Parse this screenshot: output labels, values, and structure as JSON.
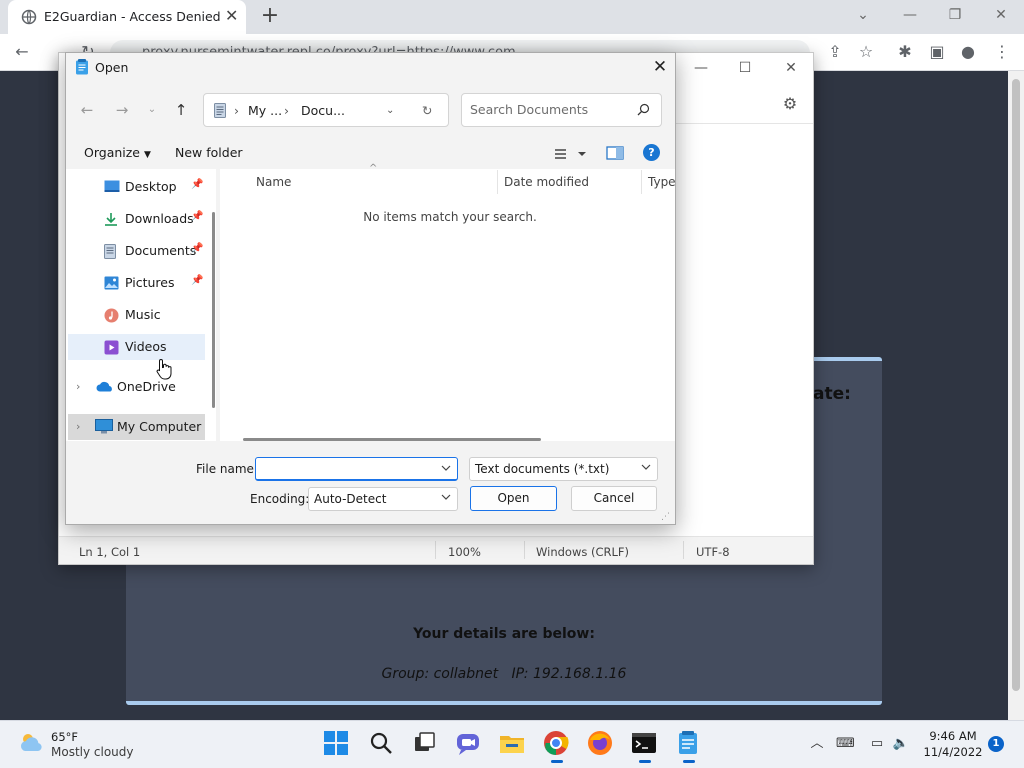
{
  "browser": {
    "tab_title": "E2Guardian - Access Denied",
    "tab_close": "✕",
    "new_tab": "+",
    "url": "proxy.nursemintwater.repl.co/proxy?url=https://www.com"
  },
  "page": {
    "heading_tail": "ate:",
    "details_title": "Your details are below:",
    "details_line": "Group: collabnet   IP: 192.168.1.16"
  },
  "notepad": {
    "status": {
      "position": "Ln 1, Col 1",
      "zoom": "100%",
      "line_endings": "Windows (CRLF)",
      "encoding": "UTF-8"
    }
  },
  "dialog": {
    "title": "Open",
    "close": "✕",
    "breadcrumb": [
      "My ...",
      "Docu..."
    ],
    "search_placeholder": "Search Documents",
    "organize": "Organize",
    "new_folder": "New folder",
    "help": "?",
    "nav": [
      {
        "label": "Desktop",
        "icon": "desktop-icon",
        "pinned": true
      },
      {
        "label": "Downloads",
        "icon": "download-icon",
        "pinned": true
      },
      {
        "label": "Documents",
        "icon": "documents-icon",
        "pinned": true
      },
      {
        "label": "Pictures",
        "icon": "pictures-icon",
        "pinned": true
      },
      {
        "label": "Music",
        "icon": "music-icon",
        "pinned": false
      },
      {
        "label": "Videos",
        "icon": "videos-icon",
        "pinned": false,
        "hovered": true
      },
      {
        "label": "OneDrive",
        "icon": "onedrive-icon",
        "expandable": true
      },
      {
        "label": "My Computer",
        "icon": "computer-icon",
        "expandable": true,
        "selected": true
      }
    ],
    "columns": [
      "Name",
      "Date modified",
      "Type"
    ],
    "empty_message": "No items match your search.",
    "file_name_label": "File name:",
    "file_name_value": "",
    "filter": "Text documents (*.txt)",
    "encoding_label": "Encoding:",
    "encoding_value": "Auto-Detect",
    "open_button": "Open",
    "cancel_button": "Cancel"
  },
  "taskbar": {
    "weather_temp": "65°F",
    "weather_desc": "Mostly cloudy",
    "time": "9:46 AM",
    "date": "11/4/2022",
    "notifications": "1"
  },
  "colors": {
    "accent": "#1a73e8",
    "page_bg": "#2f3542",
    "card_bg": "#444c5e",
    "card_border": "#a9cbee"
  }
}
